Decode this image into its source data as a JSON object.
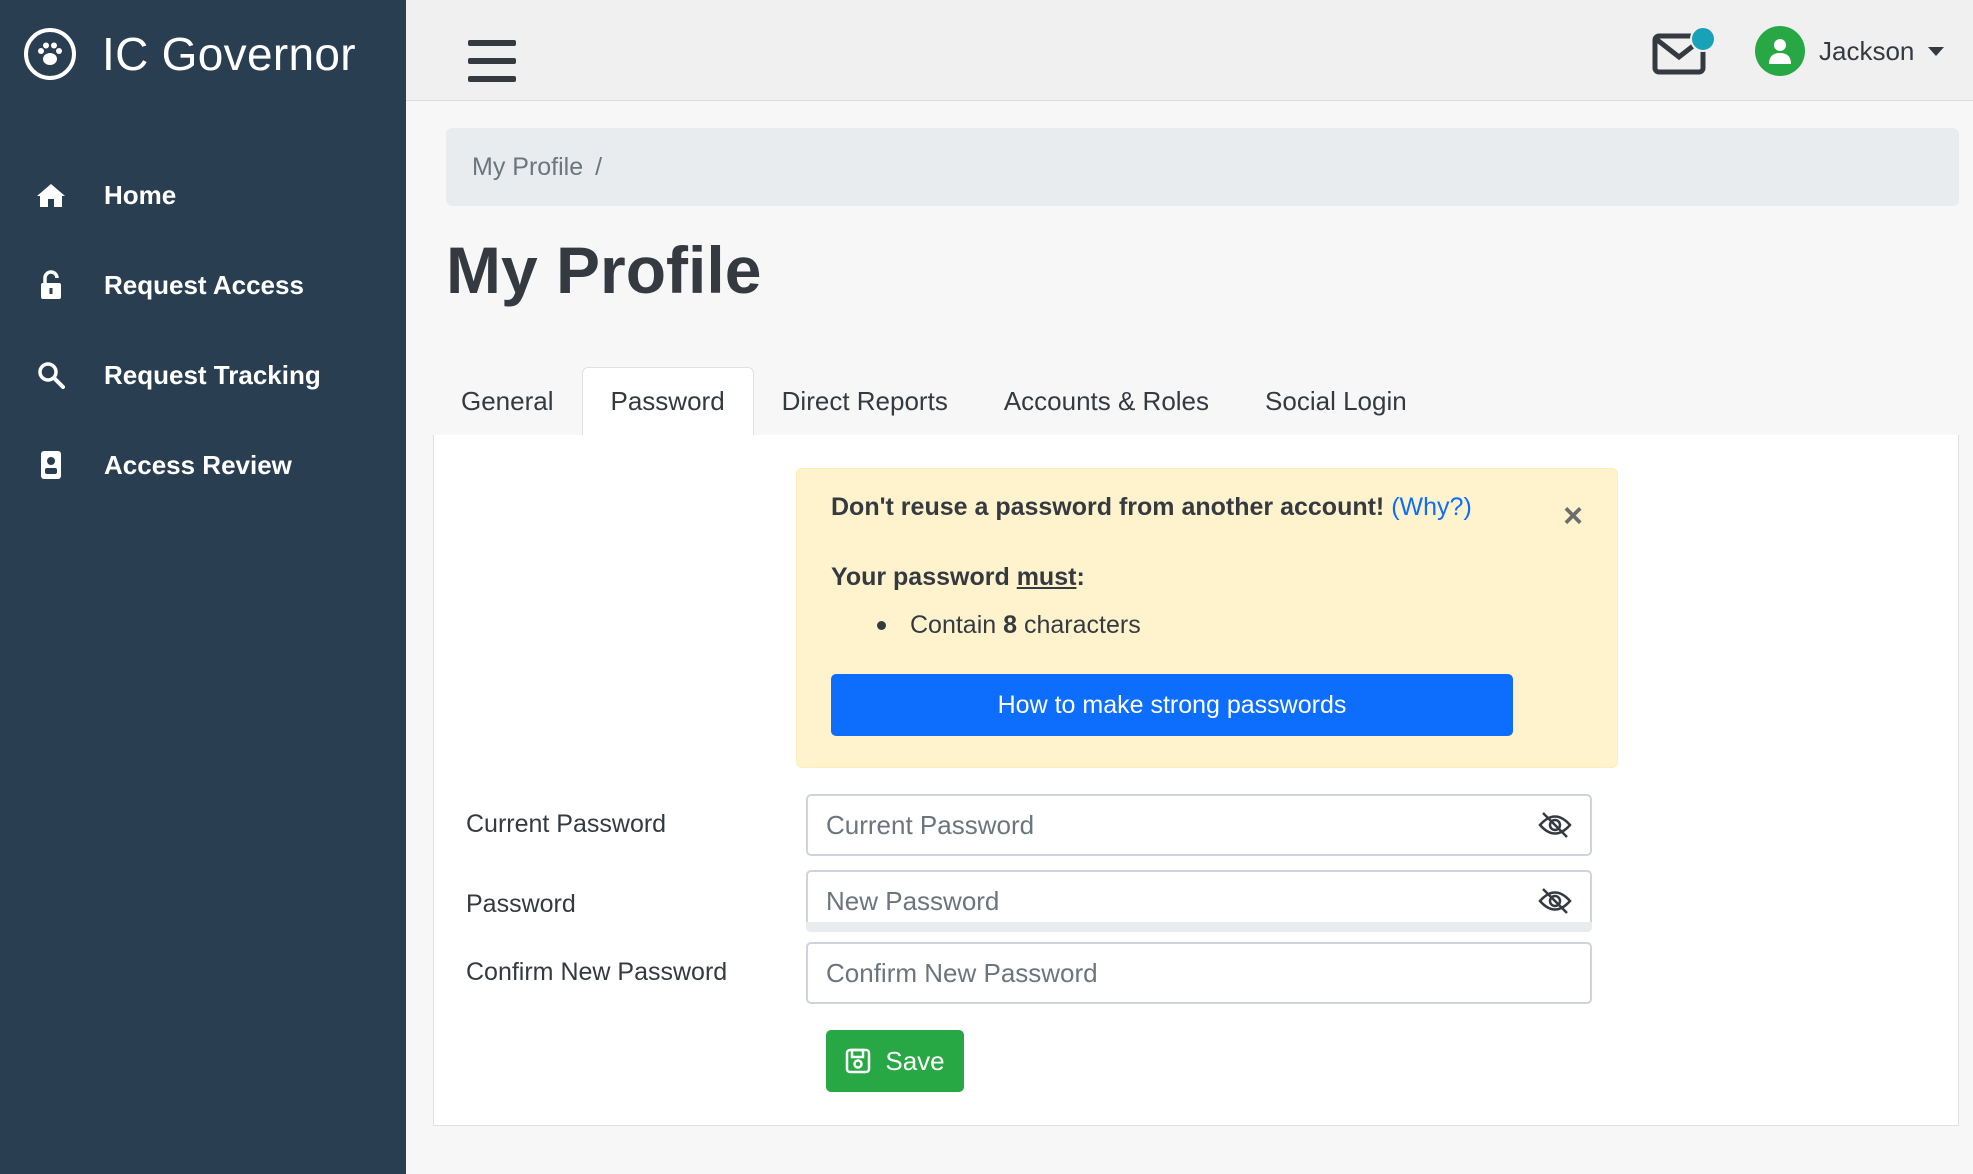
{
  "app": {
    "title": "IC Governor"
  },
  "sidebar": {
    "items": [
      {
        "label": "Home",
        "icon": "home-icon"
      },
      {
        "label": "Request Access",
        "icon": "lock-open-icon"
      },
      {
        "label": "Request Tracking",
        "icon": "search-icon"
      },
      {
        "label": "Access Review",
        "icon": "id-badge-icon"
      }
    ]
  },
  "header": {
    "user_name": "Jackson",
    "notification_color": "#17a2b8"
  },
  "breadcrumb": {
    "current": "My Profile",
    "separator": "/"
  },
  "page": {
    "title": "My Profile"
  },
  "tabs": [
    {
      "label": "General",
      "active": false
    },
    {
      "label": "Password",
      "active": true
    },
    {
      "label": "Direct Reports",
      "active": false
    },
    {
      "label": "Accounts & Roles",
      "active": false
    },
    {
      "label": "Social Login",
      "active": false
    }
  ],
  "alert": {
    "warning": "Don't reuse a password from another account!",
    "why_link": "(Why?)",
    "must_prefix": "Your password",
    "must_word": "must",
    "must_suffix": ":",
    "rule_prefix": "Contain",
    "rule_count": "8",
    "rule_suffix": "characters",
    "button": "How to make strong passwords",
    "close": "×"
  },
  "form": {
    "current_password": {
      "label": "Current Password",
      "placeholder": "Current Password",
      "value": ""
    },
    "new_password": {
      "label": "Password",
      "placeholder": "New Password",
      "value": ""
    },
    "confirm_password": {
      "label": "Confirm New Password",
      "placeholder": "Confirm New Password",
      "value": ""
    },
    "save_label": "Save"
  },
  "colors": {
    "sidebar_bg": "#2a3e52",
    "primary": "#0d6efd",
    "success": "#28a745",
    "alert_bg": "#fff3cd"
  }
}
